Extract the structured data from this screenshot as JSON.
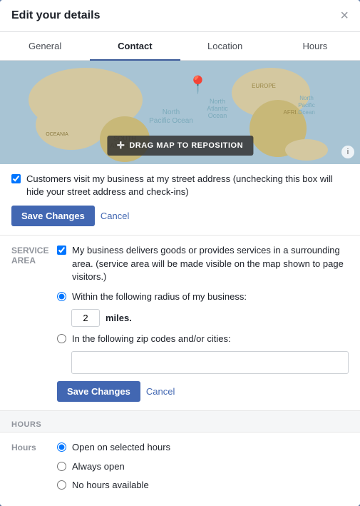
{
  "modal": {
    "title": "Edit your details",
    "close_label": "×"
  },
  "tabs": [
    {
      "id": "general",
      "label": "General",
      "active": false
    },
    {
      "id": "contact",
      "label": "Contact",
      "active": true
    },
    {
      "id": "location",
      "label": "Location",
      "active": false
    },
    {
      "id": "hours",
      "label": "Hours",
      "active": false
    }
  ],
  "map": {
    "drag_label": "DRAG MAP TO REPOSITION",
    "info_label": "i"
  },
  "street_address": {
    "checkbox_checked": true,
    "label": "Customers visit my business at my street address (unchecking this box will hide your street address and check-ins)",
    "save_label": "Save Changes",
    "cancel_label": "Cancel"
  },
  "service_area": {
    "side_label": "Service Area",
    "delivers_checked": true,
    "delivers_label": "My business delivers goods or provides services in a surrounding area. (service area will be made visible on the map shown to page visitors.)",
    "radius_checked": true,
    "radius_label": "Within the following radius of my business:",
    "miles_value": "2",
    "miles_label": "miles.",
    "zip_label": "In the following zip codes and/or cities:",
    "zip_value": "",
    "save_label": "Save Changes",
    "cancel_label": "Cancel"
  },
  "hours": {
    "section_title": "HOURS",
    "side_label": "Hours",
    "options": [
      {
        "label": "Open on selected hours",
        "checked": true
      },
      {
        "label": "Always open",
        "checked": false
      },
      {
        "label": "No hours available",
        "checked": false
      }
    ]
  }
}
